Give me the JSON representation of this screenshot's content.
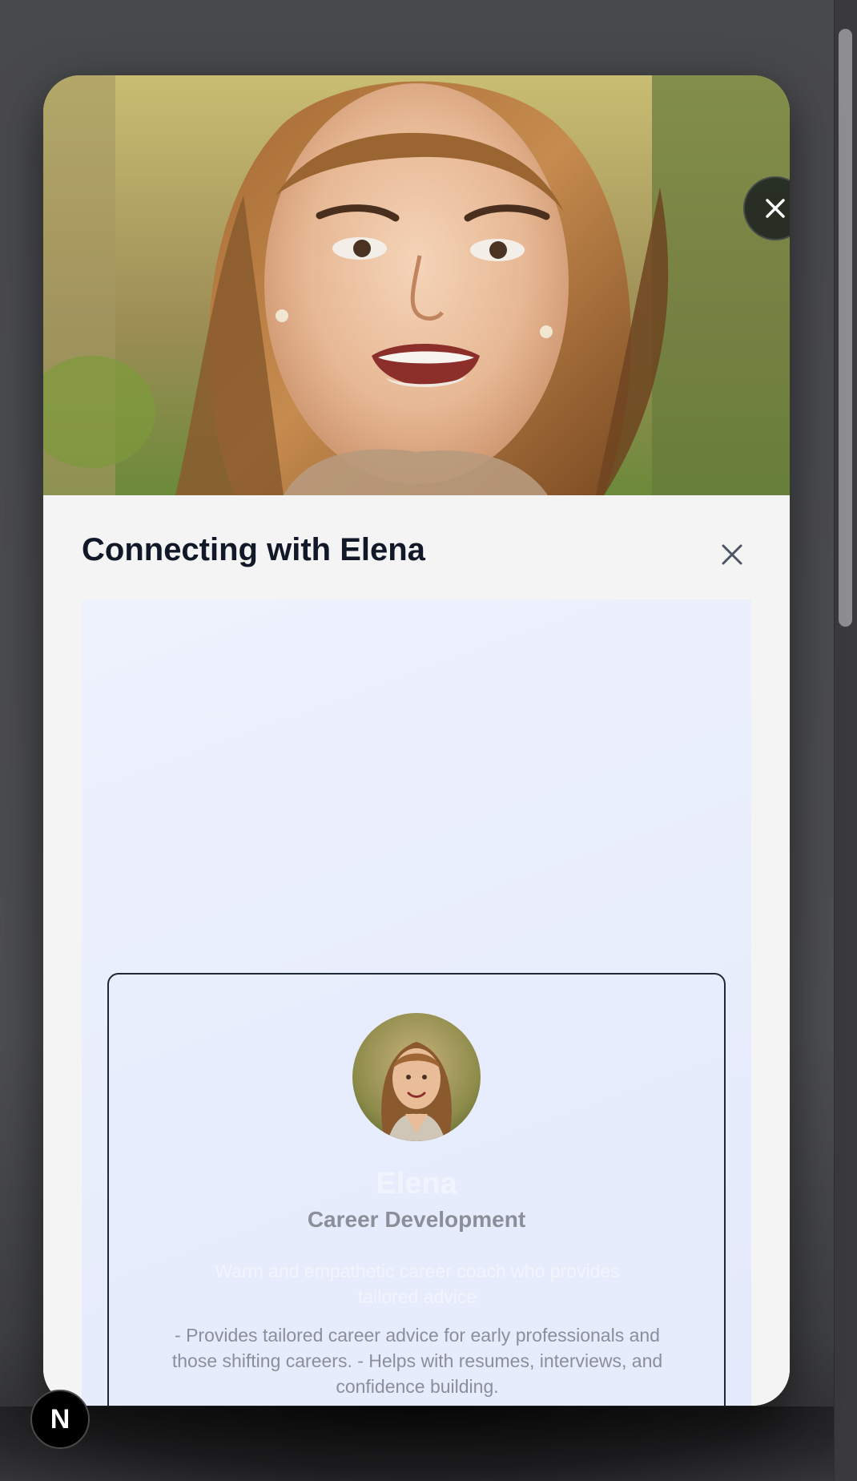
{
  "modal": {
    "title": "Connecting with Elena",
    "close_video_icon": "close-icon",
    "close_panel_icon": "close-icon"
  },
  "coach": {
    "name": "Elena",
    "category": "Career Development",
    "tagline": "Warm and empathetic career coach who provides tailored advice",
    "description": "- Provides tailored career advice for early professionals and those shifting careers. - Helps with resumes, interviews, and confidence building."
  },
  "dev_indicator": {
    "letter": "N",
    "icon": "nextjs-logo-icon"
  },
  "colors": {
    "overlay": "#4c4d4f",
    "panel": "#f4f4f5",
    "title": "#111827",
    "content_bg": "#e9eefc",
    "muted_text": "#8a8f99"
  }
}
